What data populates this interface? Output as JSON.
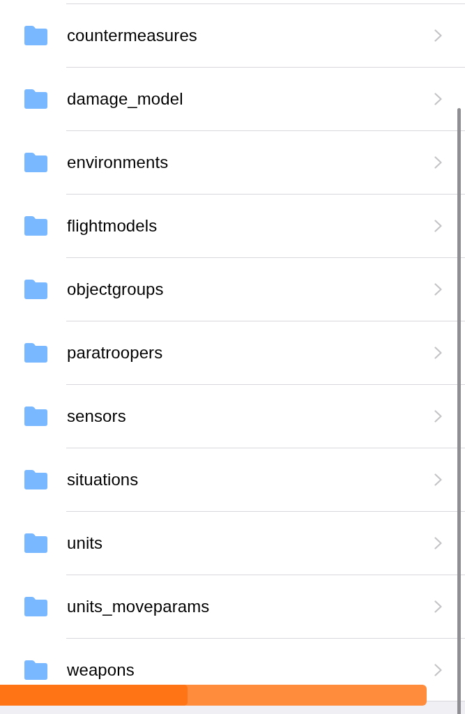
{
  "folders": [
    {
      "name": "countermeasures"
    },
    {
      "name": "damage_model"
    },
    {
      "name": "environments"
    },
    {
      "name": "flightmodels"
    },
    {
      "name": "objectgroups"
    },
    {
      "name": "paratroopers"
    },
    {
      "name": "sensors"
    },
    {
      "name": "situations"
    },
    {
      "name": "units"
    },
    {
      "name": "units_moveparams"
    },
    {
      "name": "weapons"
    }
  ],
  "progress": {
    "level": 0.44
  }
}
